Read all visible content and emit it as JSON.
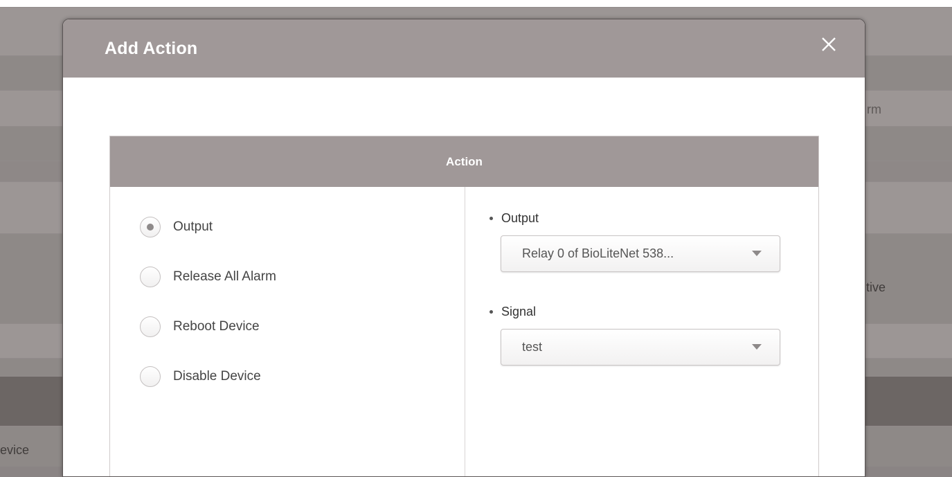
{
  "background": {
    "fragment_top_right": "rm",
    "fragment_mid_right": "tive",
    "fragment_bottom_left": "evice"
  },
  "modal": {
    "title": "Add Action",
    "close_icon": "close-icon"
  },
  "panel": {
    "header": "Action",
    "options": [
      {
        "label": "Output",
        "checked": true
      },
      {
        "label": "Release All Alarm",
        "checked": false
      },
      {
        "label": "Reboot Device",
        "checked": false
      },
      {
        "label": "Disable Device",
        "checked": false
      }
    ],
    "output": {
      "label": "Output",
      "value": "Relay 0 of BioLiteNet 538..."
    },
    "signal": {
      "label": "Signal",
      "value": "test"
    }
  },
  "colors": {
    "header_bg": "#a09898",
    "overlay_bg": "#8a8484",
    "radio_dot": "#8e8a8a"
  }
}
